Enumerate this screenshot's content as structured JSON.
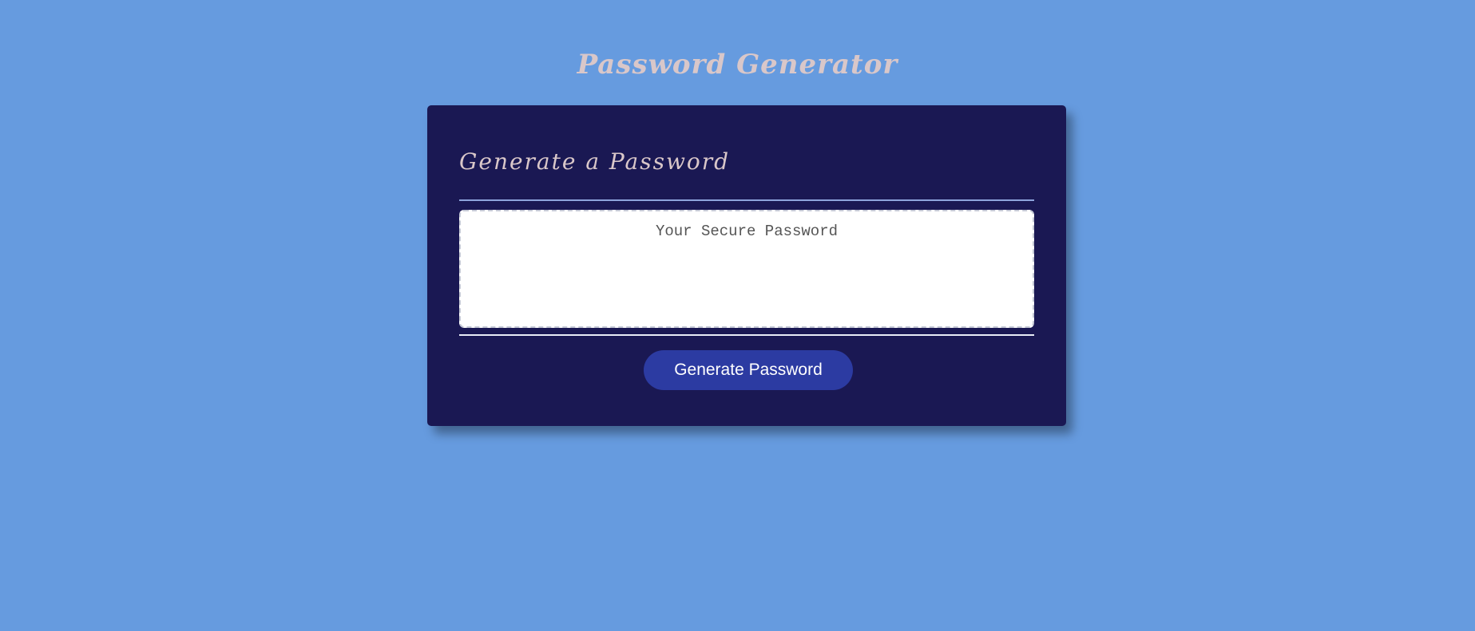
{
  "page": {
    "title": "Password Generator",
    "background_color": "#669bdf"
  },
  "card": {
    "title": "Generate a Password",
    "background_color": "#1a1853",
    "password_output": {
      "value": "",
      "placeholder": "Your Secure Password"
    },
    "generate_button": {
      "label": "Generate Password",
      "color": "#2c3ba2"
    }
  }
}
